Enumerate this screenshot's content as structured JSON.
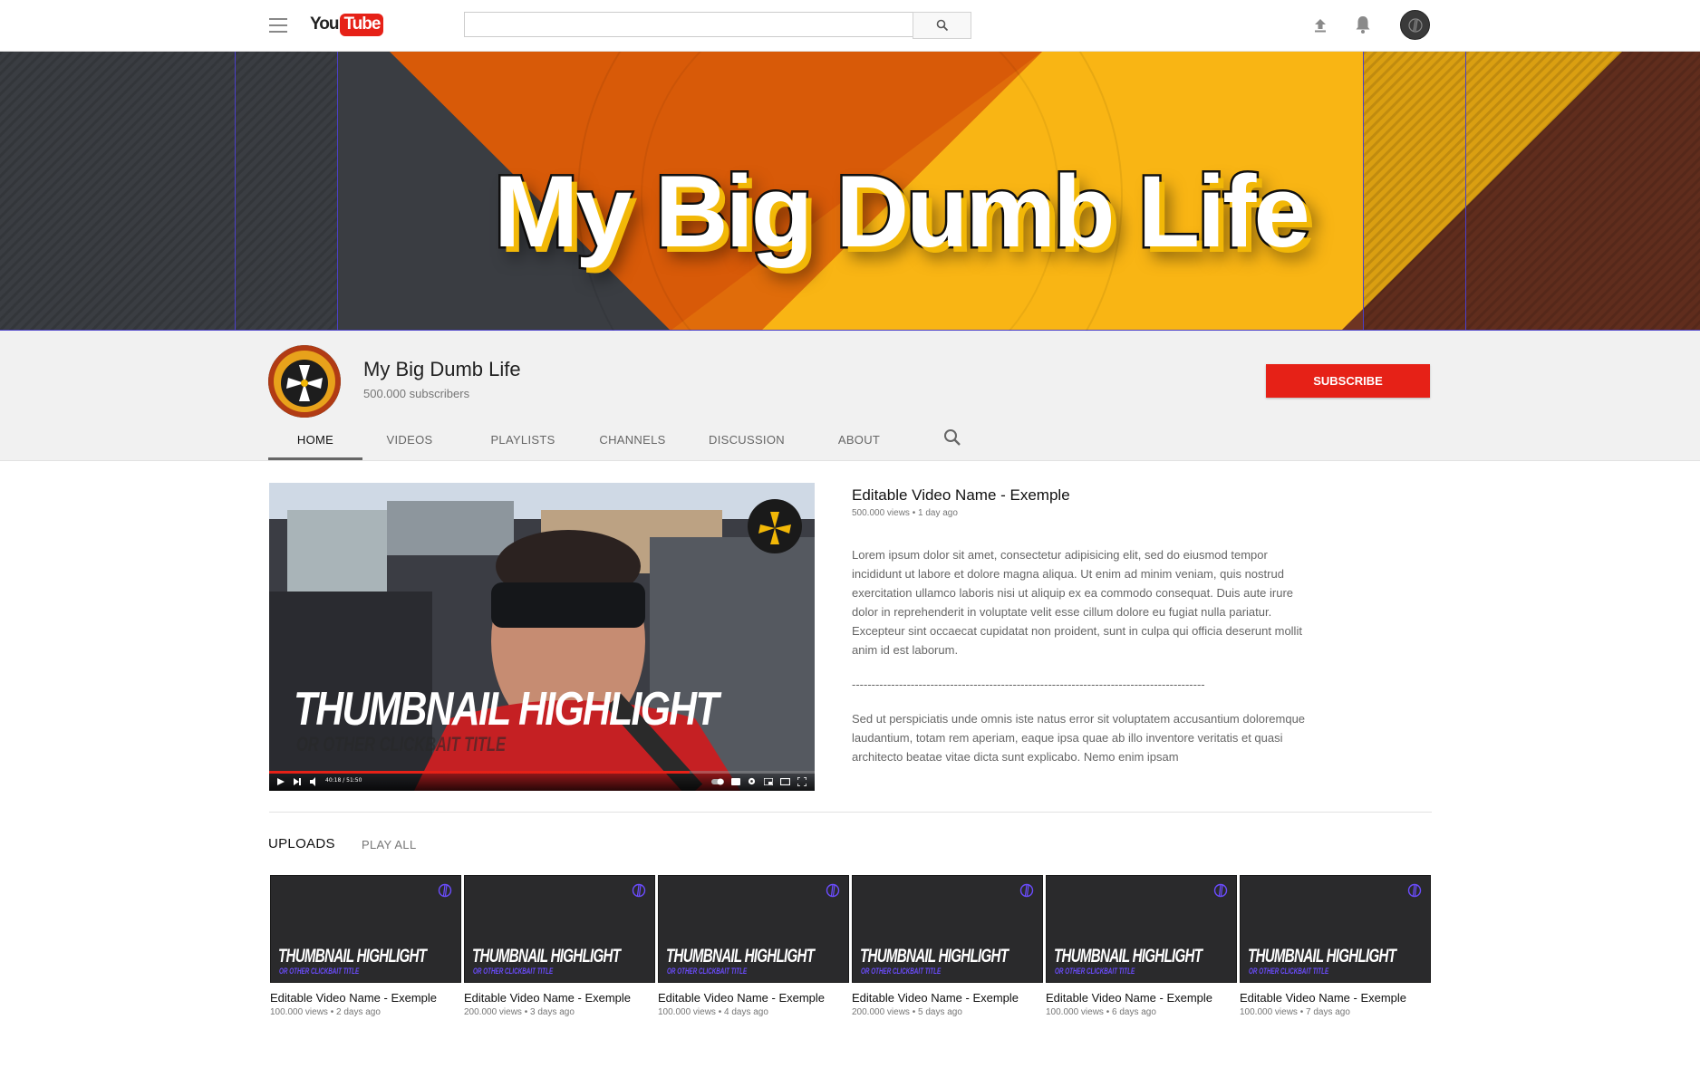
{
  "header": {
    "logo_you": "You",
    "logo_tube": "Tube",
    "search_placeholder": ""
  },
  "banner": {
    "title": "My Big Dumb Life",
    "colors": {
      "dark": "#3a3d42",
      "orange": "#d85a08",
      "yellow": "#f9b514",
      "rust": "#6e3422"
    }
  },
  "channel": {
    "name": "My Big Dumb Life",
    "subscribers": "500.000 subscribers",
    "subscribe_label": "SUBSCRIBE",
    "tabs": [
      {
        "label": "HOME",
        "active": true
      },
      {
        "label": "VIDEOS",
        "active": false
      },
      {
        "label": "PLAYLISTS",
        "active": false
      },
      {
        "label": "CHANNELS",
        "active": false
      },
      {
        "label": "DISCUSSION",
        "active": false
      },
      {
        "label": "ABOUT",
        "active": false
      }
    ]
  },
  "featured": {
    "thumb_title": "THUMBNAIL HIGHLIGHT",
    "thumb_subtitle": "OR OTHER CLICKBAIT TITLE",
    "player_time": "40:18 / 51:50",
    "progress": 0.77,
    "title": "Editable Video Name - Exemple",
    "meta": "500.000 views • 1 day ago",
    "description_1": "Lorem ipsum dolor sit amet, consectetur adipisicing elit, sed do eiusmod tempor incididunt ut labore et dolore magna aliqua. Ut enim ad minim veniam, quis nostrud exercitation ullamco laboris nisi ut aliquip ex ea commodo consequat. Duis aute irure dolor in reprehenderit in voluptate velit esse cillum dolore eu fugiat nulla pariatur. Excepteur sint occaecat cupidatat non proident, sunt in culpa qui officia deserunt mollit anim id est laborum.",
    "divider": "------------------------------------------------------------------------------------------",
    "description_2": "Sed ut perspiciatis unde omnis iste natus error sit voluptatem accusantium doloremque laudantium, totam rem aperiam, eaque ipsa quae ab illo inventore veritatis et quasi architecto beatae vitae dicta sunt explicabo. Nemo enim ipsam"
  },
  "uploads": {
    "label": "UPLOADS",
    "play_all": "PLAY ALL",
    "items": [
      {
        "thumb_title": "THUMBNAIL HIGHLIGHT",
        "thumb_subtitle": "OR OTHER CLICKBAIT TITLE",
        "title": "Editable Video Name - Exemple",
        "meta": "100.000 views • 2 days ago"
      },
      {
        "thumb_title": "THUMBNAIL HIGHLIGHT",
        "thumb_subtitle": "OR OTHER CLICKBAIT TITLE",
        "title": "Editable Video Name - Exemple",
        "meta": "200.000 views • 3 days ago"
      },
      {
        "thumb_title": "THUMBNAIL HIGHLIGHT",
        "thumb_subtitle": "OR OTHER CLICKBAIT TITLE",
        "title": "Editable Video Name - Exemple",
        "meta": "100.000 views • 4 days ago"
      },
      {
        "thumb_title": "THUMBNAIL HIGHLIGHT",
        "thumb_subtitle": "OR OTHER CLICKBAIT TITLE",
        "title": "Editable Video Name - Exemple",
        "meta": "200.000 views • 5 days ago"
      },
      {
        "thumb_title": "THUMBNAIL HIGHLIGHT",
        "thumb_subtitle": "OR OTHER CLICKBAIT TITLE",
        "title": "Editable Video Name - Exemple",
        "meta": "100.000 views • 6 days ago"
      },
      {
        "thumb_title": "THUMBNAIL HIGHLIGHT",
        "thumb_subtitle": "OR OTHER CLICKBAIT TITLE",
        "title": "Editable Video Name - Exemple",
        "meta": "100.000 views • 7 days ago"
      }
    ]
  },
  "accent": "#e62117"
}
